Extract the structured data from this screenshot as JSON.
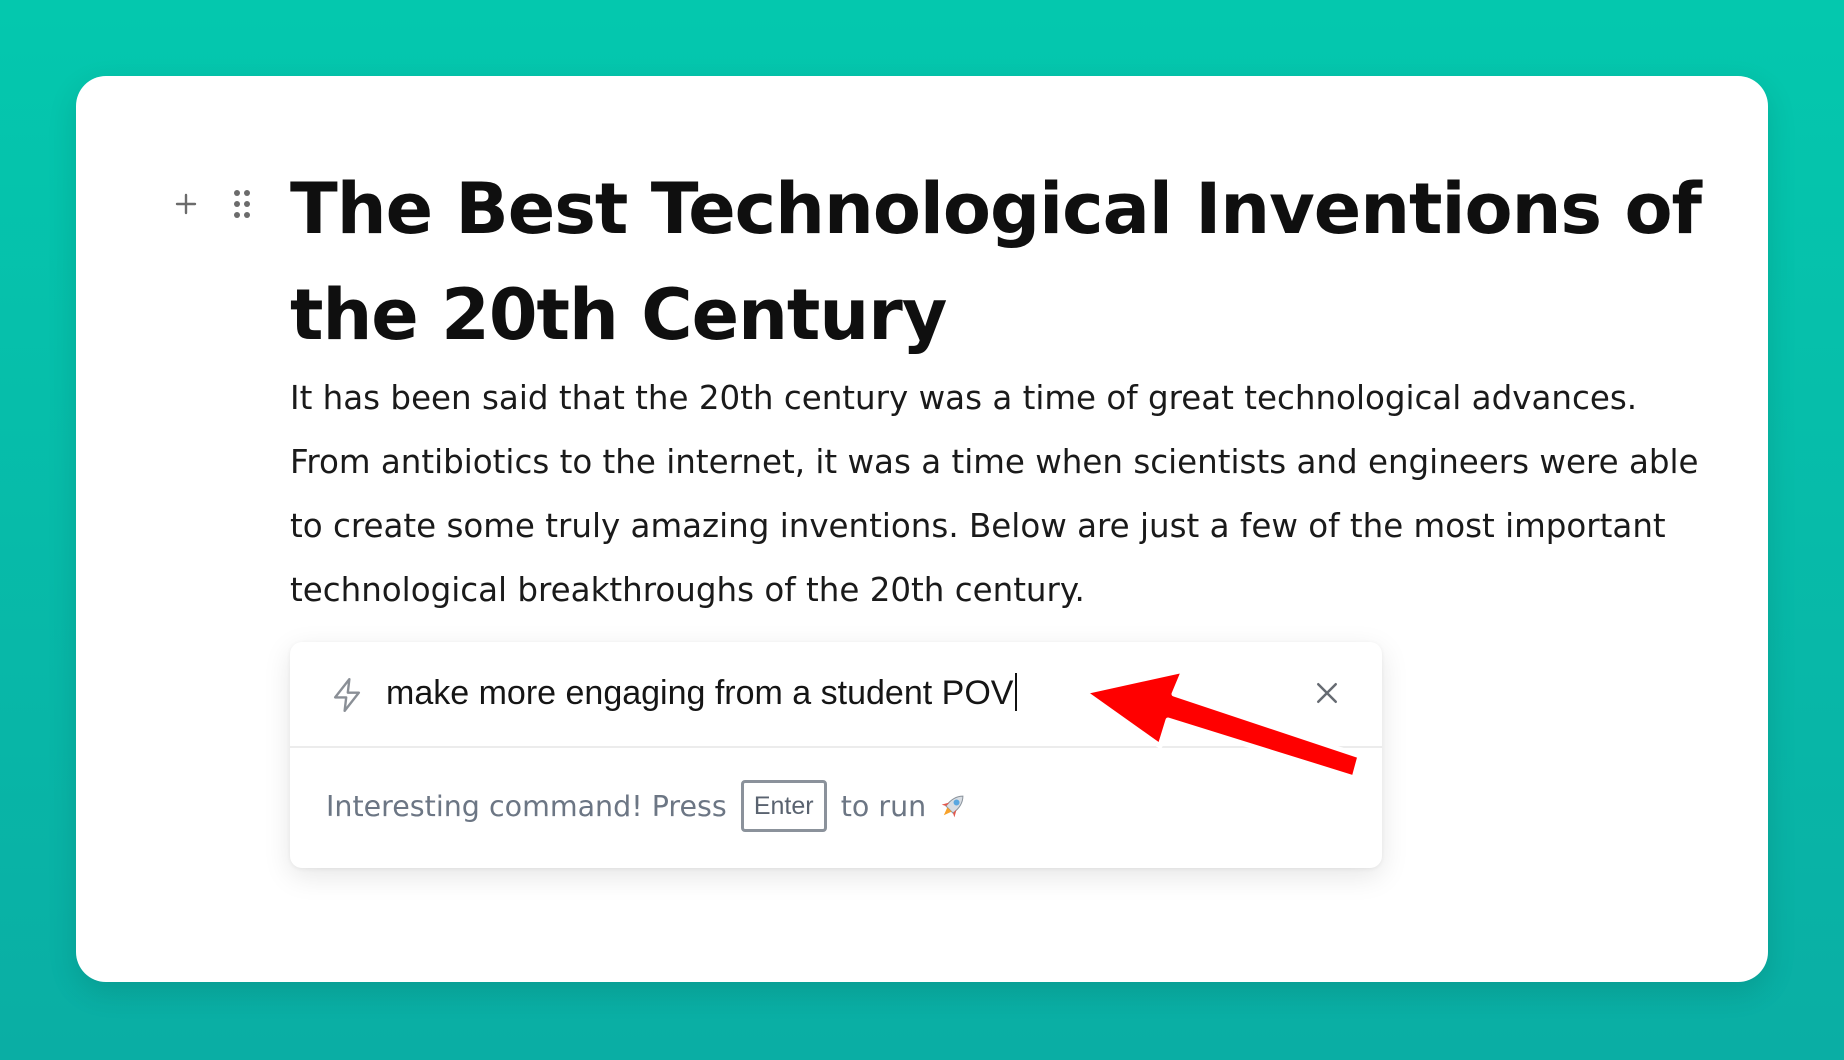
{
  "document": {
    "title": "The Best Technological Inventions of the 20th Century",
    "paragraph": "It has been said that the 20th century was a time of great technological advances. From antibiotics to the internet, it was a time when scientists and engineers were able to create some truly amazing inventions. Below are just a few of the most important technological breakthroughs of the 20th century."
  },
  "block_controls": {
    "add_icon": "plus-icon",
    "drag_icon": "drag-handle-icon"
  },
  "command_popup": {
    "input_value": "make more engaging from a student POV",
    "input_icon": "lightning-bolt-icon",
    "close_icon": "close-icon",
    "hint_prefix": "Interesting command! Press",
    "hint_key": "Enter",
    "hint_suffix": "to run",
    "hint_emoji_icon": "rocket-icon"
  },
  "annotation": {
    "arrow_color": "#ff0000"
  },
  "colors": {
    "background": "#04c8ae",
    "card": "#ffffff",
    "title_text": "#0f0f0f",
    "hint_text": "#6c7684"
  }
}
